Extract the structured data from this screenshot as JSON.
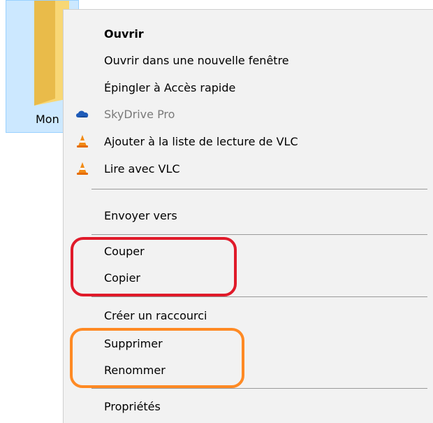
{
  "desktop": {
    "folder_label": "Mon"
  },
  "menu": {
    "groups": [
      [
        {
          "label": "Ouvrir",
          "bold": true,
          "icon": null
        },
        {
          "label": "Ouvrir dans une nouvelle fenêtre",
          "icon": null
        },
        {
          "label": "Épingler à Accès rapide",
          "icon": null
        },
        {
          "label": "SkyDrive Pro",
          "disabled": true,
          "icon": "skydrive-cloud-icon"
        },
        {
          "label": "Ajouter à la liste de lecture de VLC",
          "icon": "vlc-cone-icon"
        },
        {
          "label": "Lire avec VLC",
          "icon": "vlc-cone-icon"
        }
      ],
      [
        {
          "label": "Envoyer vers",
          "icon": null
        }
      ],
      [
        {
          "label": "Couper",
          "icon": null
        },
        {
          "label": "Copier",
          "icon": null
        }
      ],
      [
        {
          "label": "Créer un raccourci",
          "icon": null
        },
        {
          "label": "Supprimer",
          "icon": null
        },
        {
          "label": "Renommer",
          "icon": null
        }
      ],
      [
        {
          "label": "Propriétés",
          "icon": null
        }
      ]
    ]
  },
  "annotations": {
    "red_oval_color": "#e01a2a",
    "orange_oval_color": "#ff8a24"
  }
}
